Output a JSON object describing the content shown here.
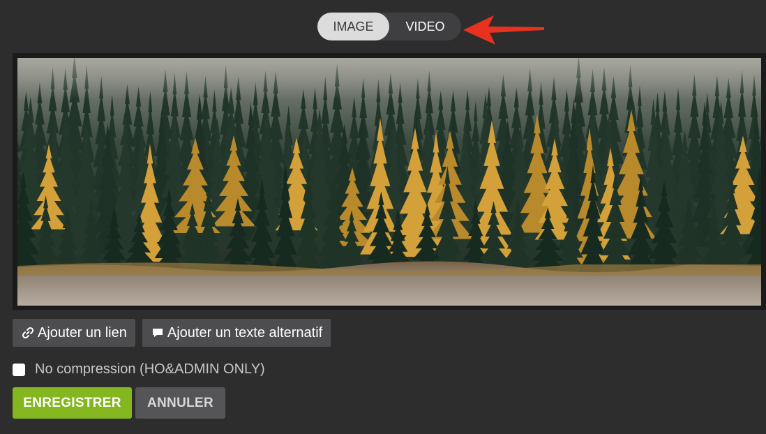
{
  "toggle": {
    "image_label": "IMAGE",
    "video_label": "VIDEO",
    "selected": "IMAGE"
  },
  "annotation": {
    "arrow_color": "#e8321f"
  },
  "media": {
    "description_icon": "forest-image"
  },
  "buttons": {
    "add_link": "Ajouter un lien",
    "add_link_icon": "link-icon",
    "add_alt": "Ajouter un texte alternatif",
    "add_alt_icon": "comment-icon"
  },
  "compression": {
    "label": "No compression (HO&ADMIN ONLY)",
    "checked": false
  },
  "actions": {
    "save": "ENREGISTRER",
    "cancel": "ANNULER",
    "save_color": "#84b61f"
  }
}
